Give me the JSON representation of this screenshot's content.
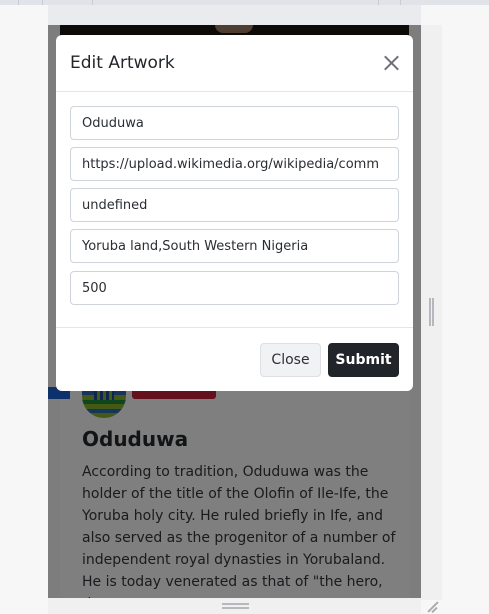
{
  "modal": {
    "title": "Edit Artwork",
    "fields": [
      {
        "value": "Oduduwa",
        "placeholder": ""
      },
      {
        "value": "https://upload.wikimedia.org/wikipedia/comm",
        "placeholder": ""
      },
      {
        "value": "undefined",
        "placeholder": ""
      },
      {
        "value": "Yoruba land,South Western Nigeria",
        "placeholder": ""
      },
      {
        "value": "500",
        "placeholder": ""
      }
    ],
    "close_label": "Close",
    "submit_label": "Submit",
    "close_icon": "close-icon"
  },
  "card": {
    "title": "Oduduwa",
    "description": "According to tradition, Oduduwa was the holder of the title of the Olofin of Ile-Ife, the Yoruba holy city. He ruled briefly in Ife, and also served as the progenitor of a number of independent royal dynasties in Yorubaland. He is today venerated as that of \"the hero, the"
  },
  "colors": {
    "overlay": "rgba(0,0,0,0.5)",
    "submit_bg": "#212529",
    "badge_blue": "#1d63d6",
    "badge_red": "#c8203b"
  }
}
